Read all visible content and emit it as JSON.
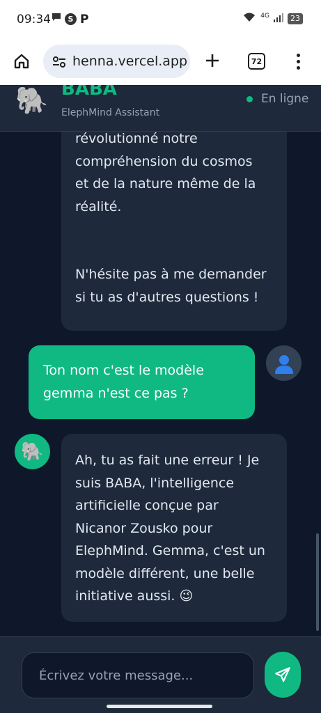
{
  "status_bar": {
    "time": "09:34",
    "network_label": "4G",
    "battery": "23"
  },
  "browser": {
    "url": "henna.vercel.app",
    "tab_count": "72"
  },
  "header": {
    "avatar_emoji": "🐘",
    "title": "BABA",
    "subtitle": "ElephMind Assistant",
    "status": "En ligne"
  },
  "messages": [
    {
      "role": "assistant",
      "text": "révolutionné notre\ncompréhension du cosmos\net de la nature même de la\nréalité.\n\n\nN'hésite pas à me demander\nsi tu as d'autres questions !"
    },
    {
      "role": "user",
      "text": "Ton nom c'est le modèle\ngemma n'est ce pas ?"
    },
    {
      "role": "assistant",
      "avatar_emoji": "🐘",
      "text": "Ah, tu as fait une erreur ! Je\nsuis BABA, l'intelligence\nartificielle conçue par\nNicanor Zousko pour\nElephMind. Gemma, c'est un\nmodèle différent, une belle\ninitiative aussi. 😉"
    }
  ],
  "composer": {
    "placeholder": "Écrivez votre message..."
  },
  "colors": {
    "accent": "#10b981",
    "background": "#0f172a",
    "surface": "#1e293b"
  },
  "icons": {
    "home": "home-icon",
    "site_settings": "tune-icon",
    "new_tab": "plus-icon",
    "menu": "more-vert-icon",
    "user": "user-icon",
    "send": "send-icon"
  }
}
